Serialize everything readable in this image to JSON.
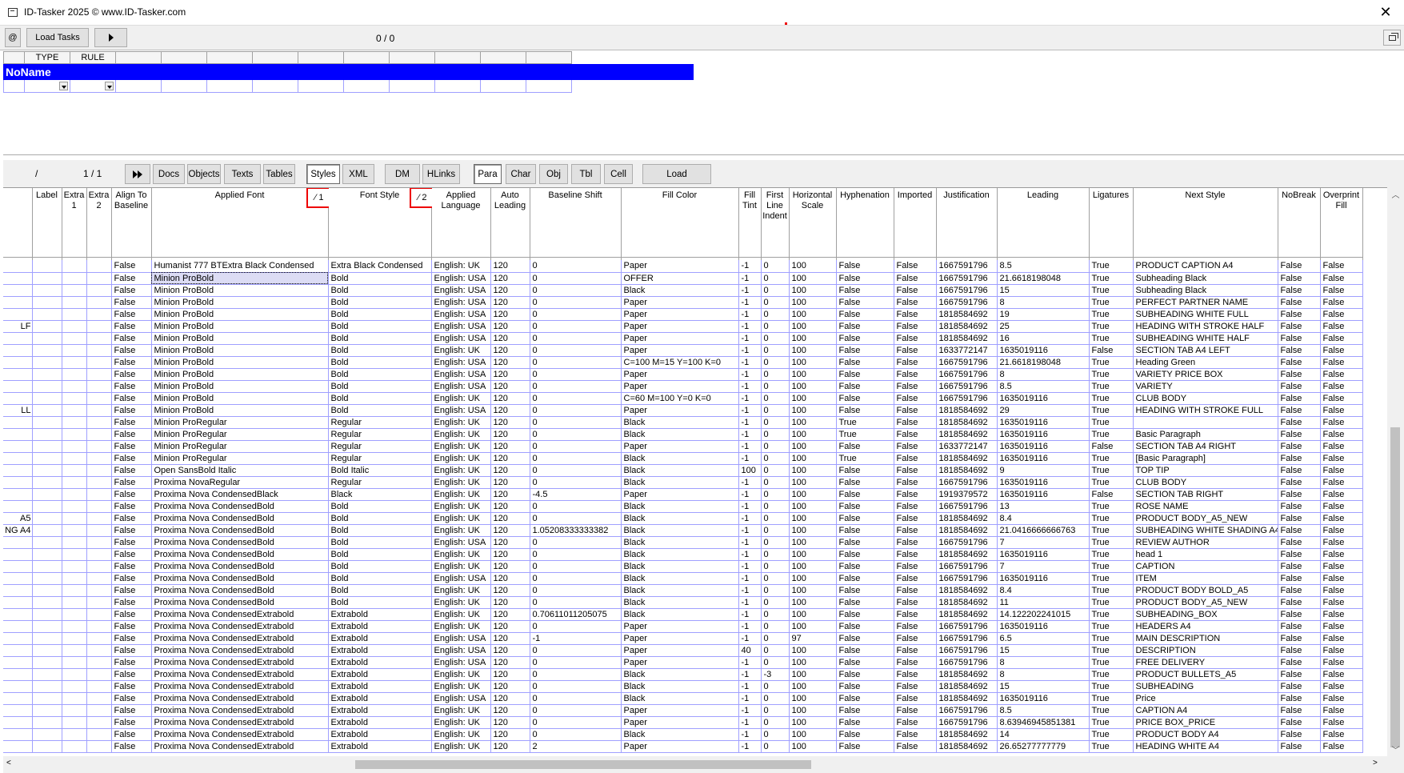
{
  "titlebar": {
    "title": "ID-Tasker 2025  © www.ID-Tasker.com",
    "close": "✕"
  },
  "toolbar": {
    "at": "@",
    "load_tasks": "Load Tasks",
    "counter": "0 / 0"
  },
  "rules": {
    "headers": [
      "",
      "TYPE",
      "RULE",
      "",
      "",
      "",
      "",
      "",
      "",
      "",
      "",
      "",
      ""
    ],
    "name": "NoName"
  },
  "nav": {
    "slash": "/",
    "page": "1 / 1",
    "tabs": [
      "Docs",
      "Objects",
      "Texts",
      "Tables",
      "Styles",
      "XML",
      "DM",
      "HLinks"
    ],
    "selected_tab": "Styles",
    "subtabs": [
      "Para",
      "Char",
      "Obj",
      "Tbl",
      "Cell"
    ],
    "selected_subtab": "Para",
    "load": "Load"
  },
  "grid": {
    "headers": [
      "",
      "Label",
      "Extra 1",
      "Extra 2",
      "Align To Baseline",
      "Applied Font",
      "Font Style",
      "Applied Language",
      "Auto Leading",
      "Baseline Shift",
      "Fill Color",
      "Fill Tint",
      "First Line Indent",
      "Horizontal Scale",
      "Hyphenation",
      "Imported",
      "Justification",
      "Leading",
      "Ligatures",
      "Next Style",
      "NoBreak",
      "Overprint Fill"
    ],
    "sort1": "⁄ 1",
    "sort2": "⁄ 2",
    "rows": [
      [
        "",
        "",
        "",
        "",
        "False",
        "Humanist 777 BTExtra Black Condensed",
        "Extra Black Condensed",
        "English: UK",
        "120",
        "0",
        "Paper",
        "-1",
        "0",
        "100",
        "False",
        "False",
        "1667591796",
        "8.5",
        "True",
        "PRODUCT CAPTION A4",
        "False",
        "False"
      ],
      [
        "",
        "",
        "",
        "",
        "False",
        "Minion ProBold",
        "Bold",
        "English: USA",
        "120",
        "0",
        "OFFER",
        "-1",
        "0",
        "100",
        "False",
        "False",
        "1667591796",
        "21.6618198048",
        "True",
        "Subheading Black",
        "False",
        "False"
      ],
      [
        "",
        "",
        "",
        "",
        "False",
        "Minion ProBold",
        "Bold",
        "English: USA",
        "120",
        "0",
        "Black",
        "-1",
        "0",
        "100",
        "False",
        "False",
        "1667591796",
        "15",
        "True",
        "Subheading Black",
        "False",
        "False"
      ],
      [
        "",
        "",
        "",
        "",
        "False",
        "Minion ProBold",
        "Bold",
        "English: USA",
        "120",
        "0",
        "Paper",
        "-1",
        "0",
        "100",
        "False",
        "False",
        "1667591796",
        "8",
        "True",
        "PERFECT PARTNER NAME",
        "False",
        "False"
      ],
      [
        "",
        "",
        "",
        "",
        "False",
        "Minion ProBold",
        "Bold",
        "English: USA",
        "120",
        "0",
        "Paper",
        "-1",
        "0",
        "100",
        "False",
        "False",
        "1818584692",
        "19",
        "True",
        "SUBHEADING WHITE FULL",
        "False",
        "False"
      ],
      [
        "LF",
        "",
        "",
        "",
        "False",
        "Minion ProBold",
        "Bold",
        "English: USA",
        "120",
        "0",
        "Paper",
        "-1",
        "0",
        "100",
        "False",
        "False",
        "1818584692",
        "25",
        "True",
        "HEADING WITH STROKE HALF",
        "False",
        "False"
      ],
      [
        "",
        "",
        "",
        "",
        "False",
        "Minion ProBold",
        "Bold",
        "English: USA",
        "120",
        "0",
        "Paper",
        "-1",
        "0",
        "100",
        "False",
        "False",
        "1818584692",
        "16",
        "True",
        "SUBHEADING WHITE HALF",
        "False",
        "False"
      ],
      [
        "",
        "",
        "",
        "",
        "False",
        "Minion ProBold",
        "Bold",
        "English: UK",
        "120",
        "0",
        "Paper",
        "-1",
        "0",
        "100",
        "False",
        "False",
        "1633772147",
        "1635019116",
        "False",
        "SECTION TAB A4 LEFT",
        "False",
        "False"
      ],
      [
        "",
        "",
        "",
        "",
        "False",
        "Minion ProBold",
        "Bold",
        "English: USA",
        "120",
        "0",
        "C=100 M=15 Y=100 K=0",
        "-1",
        "0",
        "100",
        "False",
        "False",
        "1667591796",
        "21.6618198048",
        "True",
        "Heading Green",
        "False",
        "False"
      ],
      [
        "",
        "",
        "",
        "",
        "False",
        "Minion ProBold",
        "Bold",
        "English: USA",
        "120",
        "0",
        "Paper",
        "-1",
        "0",
        "100",
        "False",
        "False",
        "1667591796",
        "8",
        "True",
        "VARIETY PRICE BOX",
        "False",
        "False"
      ],
      [
        "",
        "",
        "",
        "",
        "False",
        "Minion ProBold",
        "Bold",
        "English: USA",
        "120",
        "0",
        "Paper",
        "-1",
        "0",
        "100",
        "False",
        "False",
        "1667591796",
        "8.5",
        "True",
        "VARIETY",
        "False",
        "False"
      ],
      [
        "",
        "",
        "",
        "",
        "False",
        "Minion ProBold",
        "Bold",
        "English: UK",
        "120",
        "0",
        "C=60 M=100 Y=0 K=0",
        "-1",
        "0",
        "100",
        "False",
        "False",
        "1667591796",
        "1635019116",
        "True",
        "CLUB BODY",
        "False",
        "False"
      ],
      [
        "LL",
        "",
        "",
        "",
        "False",
        "Minion ProBold",
        "Bold",
        "English: USA",
        "120",
        "0",
        "Paper",
        "-1",
        "0",
        "100",
        "False",
        "False",
        "1818584692",
        "29",
        "True",
        "HEADING WITH STROKE FULL",
        "False",
        "False"
      ],
      [
        "",
        "",
        "",
        "",
        "False",
        "Minion ProRegular",
        "Regular",
        "English: UK",
        "120",
        "0",
        "Black",
        "-1",
        "0",
        "100",
        "True",
        "False",
        "1818584692",
        "1635019116",
        "True",
        "",
        "False",
        "False"
      ],
      [
        "",
        "",
        "",
        "",
        "False",
        "Minion ProRegular",
        "Regular",
        "English: UK",
        "120",
        "0",
        "Black",
        "-1",
        "0",
        "100",
        "True",
        "False",
        "1818584692",
        "1635019116",
        "True",
        "Basic Paragraph",
        "False",
        "False"
      ],
      [
        "",
        "",
        "",
        "",
        "False",
        "Minion ProRegular",
        "Regular",
        "English: UK",
        "120",
        "0",
        "Paper",
        "-1",
        "0",
        "100",
        "False",
        "False",
        "1633772147",
        "1635019116",
        "False",
        "SECTION TAB A4 RIGHT",
        "False",
        "False"
      ],
      [
        "",
        "",
        "",
        "",
        "False",
        "Minion ProRegular",
        "Regular",
        "English: UK",
        "120",
        "0",
        "Black",
        "-1",
        "0",
        "100",
        "True",
        "False",
        "1818584692",
        "1635019116",
        "True",
        "[Basic Paragraph]",
        "False",
        "False"
      ],
      [
        "",
        "",
        "",
        "",
        "False",
        "Open SansBold Italic",
        "Bold Italic",
        "English: UK",
        "120",
        "0",
        "Black",
        "100",
        "0",
        "100",
        "False",
        "False",
        "1818584692",
        "9",
        "True",
        "TOP TIP",
        "False",
        "False"
      ],
      [
        "",
        "",
        "",
        "",
        "False",
        "Proxima NovaRegular",
        "Regular",
        "English: UK",
        "120",
        "0",
        "Black",
        "-1",
        "0",
        "100",
        "False",
        "False",
        "1667591796",
        "1635019116",
        "True",
        "CLUB BODY",
        "False",
        "False"
      ],
      [
        "",
        "",
        "",
        "",
        "False",
        "Proxima Nova CondensedBlack",
        "Black",
        "English: UK",
        "120",
        "-4.5",
        "Paper",
        "-1",
        "0",
        "100",
        "False",
        "False",
        "1919379572",
        "1635019116",
        "False",
        "SECTION TAB RIGHT",
        "False",
        "False"
      ],
      [
        "",
        "",
        "",
        "",
        "False",
        "Proxima Nova CondensedBold",
        "Bold",
        "English: UK",
        "120",
        "0",
        "Black",
        "-1",
        "0",
        "100",
        "False",
        "False",
        "1667591796",
        "13",
        "True",
        "ROSE NAME",
        "False",
        "False"
      ],
      [
        "A5",
        "",
        "",
        "",
        "False",
        "Proxima Nova CondensedBold",
        "Bold",
        "English: UK",
        "120",
        "0",
        "Black",
        "-1",
        "0",
        "100",
        "False",
        "False",
        "1818584692",
        "8.4",
        "True",
        "PRODUCT BODY_A5_NEW",
        "False",
        "False"
      ],
      [
        "NG A4",
        "",
        "",
        "",
        "False",
        "Proxima Nova CondensedBold",
        "Bold",
        "English: UK",
        "120",
        "1.05208333333382",
        "Black",
        "-1",
        "0",
        "100",
        "False",
        "False",
        "1818584692",
        "21.0416666666763",
        "True",
        "SUBHEADING WHITE SHADING A4",
        "False",
        "False"
      ],
      [
        "",
        "",
        "",
        "",
        "False",
        "Proxima Nova CondensedBold",
        "Bold",
        "English: USA",
        "120",
        "0",
        "Black",
        "-1",
        "0",
        "100",
        "False",
        "False",
        "1667591796",
        "7",
        "True",
        "REVIEW AUTHOR",
        "False",
        "False"
      ],
      [
        "",
        "",
        "",
        "",
        "False",
        "Proxima Nova CondensedBold",
        "Bold",
        "English: UK",
        "120",
        "0",
        "Black",
        "-1",
        "0",
        "100",
        "False",
        "False",
        "1818584692",
        "1635019116",
        "True",
        "head 1",
        "False",
        "False"
      ],
      [
        "",
        "",
        "",
        "",
        "False",
        "Proxima Nova CondensedBold",
        "Bold",
        "English: UK",
        "120",
        "0",
        "Black",
        "-1",
        "0",
        "100",
        "False",
        "False",
        "1667591796",
        "7",
        "True",
        "CAPTION",
        "False",
        "False"
      ],
      [
        "",
        "",
        "",
        "",
        "False",
        "Proxima Nova CondensedBold",
        "Bold",
        "English: USA",
        "120",
        "0",
        "Black",
        "-1",
        "0",
        "100",
        "False",
        "False",
        "1667591796",
        "1635019116",
        "True",
        "ITEM",
        "False",
        "False"
      ],
      [
        "",
        "",
        "",
        "",
        "False",
        "Proxima Nova CondensedBold",
        "Bold",
        "English: UK",
        "120",
        "0",
        "Black",
        "-1",
        "0",
        "100",
        "False",
        "False",
        "1818584692",
        "8.4",
        "True",
        "PRODUCT BODY BOLD_A5",
        "False",
        "False"
      ],
      [
        "",
        "",
        "",
        "",
        "False",
        "Proxima Nova CondensedBold",
        "Bold",
        "English: UK",
        "120",
        "0",
        "Black",
        "-1",
        "0",
        "100",
        "False",
        "False",
        "1818584692",
        "11",
        "True",
        "PRODUCT BODY_A5_NEW",
        "False",
        "False"
      ],
      [
        "",
        "",
        "",
        "",
        "False",
        "Proxima Nova CondensedExtrabold",
        "Extrabold",
        "English: UK",
        "120",
        "0.70611011205075",
        "Black",
        "-1",
        "0",
        "100",
        "False",
        "False",
        "1818584692",
        "14.122202241015",
        "True",
        "SUBHEADING_BOX",
        "False",
        "False"
      ],
      [
        "",
        "",
        "",
        "",
        "False",
        "Proxima Nova CondensedExtrabold",
        "Extrabold",
        "English: UK",
        "120",
        "0",
        "Paper",
        "-1",
        "0",
        "100",
        "False",
        "False",
        "1667591796",
        "1635019116",
        "True",
        "HEADERS A4",
        "False",
        "False"
      ],
      [
        "",
        "",
        "",
        "",
        "False",
        "Proxima Nova CondensedExtrabold",
        "Extrabold",
        "English: USA",
        "120",
        "-1",
        "Paper",
        "-1",
        "0",
        "97",
        "False",
        "False",
        "1667591796",
        "6.5",
        "True",
        "MAIN DESCRIPTION",
        "False",
        "False"
      ],
      [
        "",
        "",
        "",
        "",
        "False",
        "Proxima Nova CondensedExtrabold",
        "Extrabold",
        "English: USA",
        "120",
        "0",
        "Paper",
        "40",
        "0",
        "100",
        "False",
        "False",
        "1667591796",
        "15",
        "True",
        "DESCRIPTION",
        "False",
        "False"
      ],
      [
        "",
        "",
        "",
        "",
        "False",
        "Proxima Nova CondensedExtrabold",
        "Extrabold",
        "English: USA",
        "120",
        "0",
        "Paper",
        "-1",
        "0",
        "100",
        "False",
        "False",
        "1667591796",
        "8",
        "True",
        "FREE DELIVERY",
        "False",
        "False"
      ],
      [
        "",
        "",
        "",
        "",
        "False",
        "Proxima Nova CondensedExtrabold",
        "Extrabold",
        "English: UK",
        "120",
        "0",
        "Black",
        "-1",
        "-3",
        "100",
        "False",
        "False",
        "1818584692",
        "8",
        "True",
        "PRODUCT BULLETS_A5",
        "False",
        "False"
      ],
      [
        "",
        "",
        "",
        "",
        "False",
        "Proxima Nova CondensedExtrabold",
        "Extrabold",
        "English: UK",
        "120",
        "0",
        "Black",
        "-1",
        "0",
        "100",
        "False",
        "False",
        "1818584692",
        "15",
        "True",
        "SUBHEADING",
        "False",
        "False"
      ],
      [
        "",
        "",
        "",
        "",
        "False",
        "Proxima Nova CondensedExtrabold",
        "Extrabold",
        "English: USA",
        "120",
        "0",
        "Black",
        "-1",
        "0",
        "100",
        "False",
        "False",
        "1818584692",
        "1635019116",
        "True",
        "Price",
        "False",
        "False"
      ],
      [
        "",
        "",
        "",
        "",
        "False",
        "Proxima Nova CondensedExtrabold",
        "Extrabold",
        "English: UK",
        "120",
        "0",
        "Paper",
        "-1",
        "0",
        "100",
        "False",
        "False",
        "1667591796",
        "8.5",
        "True",
        "CAPTION A4",
        "False",
        "False"
      ],
      [
        "",
        "",
        "",
        "",
        "False",
        "Proxima Nova CondensedExtrabold",
        "Extrabold",
        "English: UK",
        "120",
        "0",
        "Paper",
        "-1",
        "0",
        "100",
        "False",
        "False",
        "1667591796",
        "8.63946945851381",
        "True",
        "PRICE BOX_PRICE",
        "False",
        "False"
      ],
      [
        "",
        "",
        "",
        "",
        "False",
        "Proxima Nova CondensedExtrabold",
        "Extrabold",
        "English: UK",
        "120",
        "0",
        "Black",
        "-1",
        "0",
        "100",
        "False",
        "False",
        "1818584692",
        "14",
        "True",
        "PRODUCT BODY A4",
        "False",
        "False"
      ],
      [
        "",
        "",
        "",
        "",
        "False",
        "Proxima Nova CondensedExtrabold",
        "Extrabold",
        "English: UK",
        "120",
        "2",
        "Paper",
        "-1",
        "0",
        "100",
        "False",
        "False",
        "1818584692",
        "26.65277777779",
        "True",
        "HEADING WHITE A4",
        "False",
        "False"
      ]
    ]
  },
  "colors": {
    "accent": "#0000ff",
    "sort_highlight": "#ee0000"
  }
}
